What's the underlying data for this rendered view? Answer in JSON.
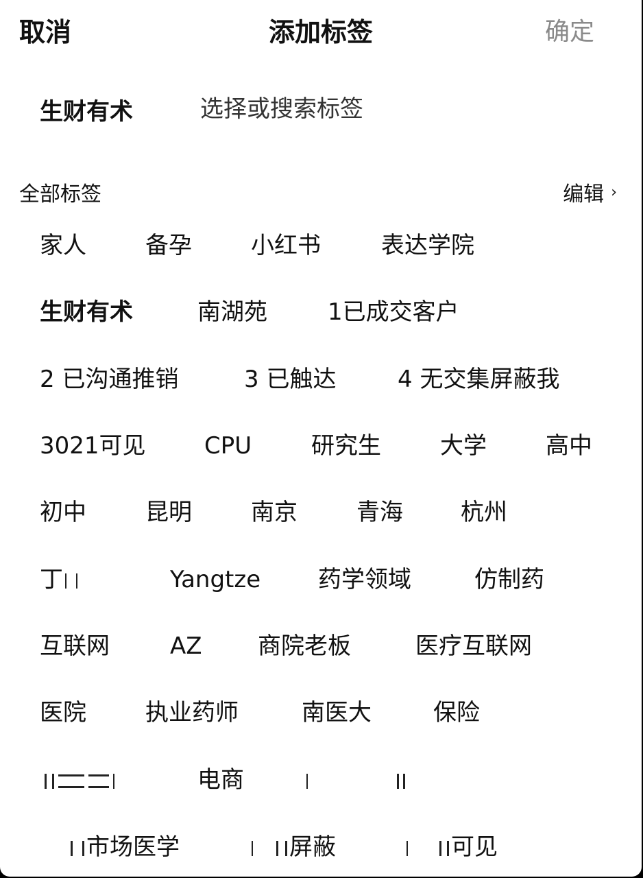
{
  "nav": {
    "cancel_label": "取消",
    "title": "添加标签",
    "confirm_label": "确定"
  },
  "input": {
    "selected_tag": "生财有术",
    "placeholder": "选择或搜索标签"
  },
  "all_tags": {
    "title": "全部标签",
    "edit_label": "编辑",
    "chevron_icon": "chevron-right-icon",
    "rows": [
      [
        "家人",
        "备孕",
        "小红书",
        "表达学院"
      ],
      [
        "生财有术",
        "南湖苑",
        "1已成交客户"
      ],
      [
        "2 已沟通推销",
        "3 已触达",
        "4 无交集屏蔽我"
      ],
      [
        "3021可见",
        "CPU",
        "研究生",
        "大学",
        "高中"
      ],
      [
        "初中",
        "昆明",
        "南京",
        "青海",
        "杭州"
      ],
      [
        "丁",
        "Yangtze",
        "药学领域",
        "仿制药"
      ],
      [
        "互联网",
        "AZ",
        "商院老板",
        "医疗互联网"
      ],
      [
        "医院",
        "执业药师",
        "南医大",
        "保险"
      ],
      [
        "",
        "电商",
        ""
      ],
      [
        "市场医学",
        "屏蔽",
        "可见"
      ]
    ],
    "selected_tag": "生财有术"
  }
}
